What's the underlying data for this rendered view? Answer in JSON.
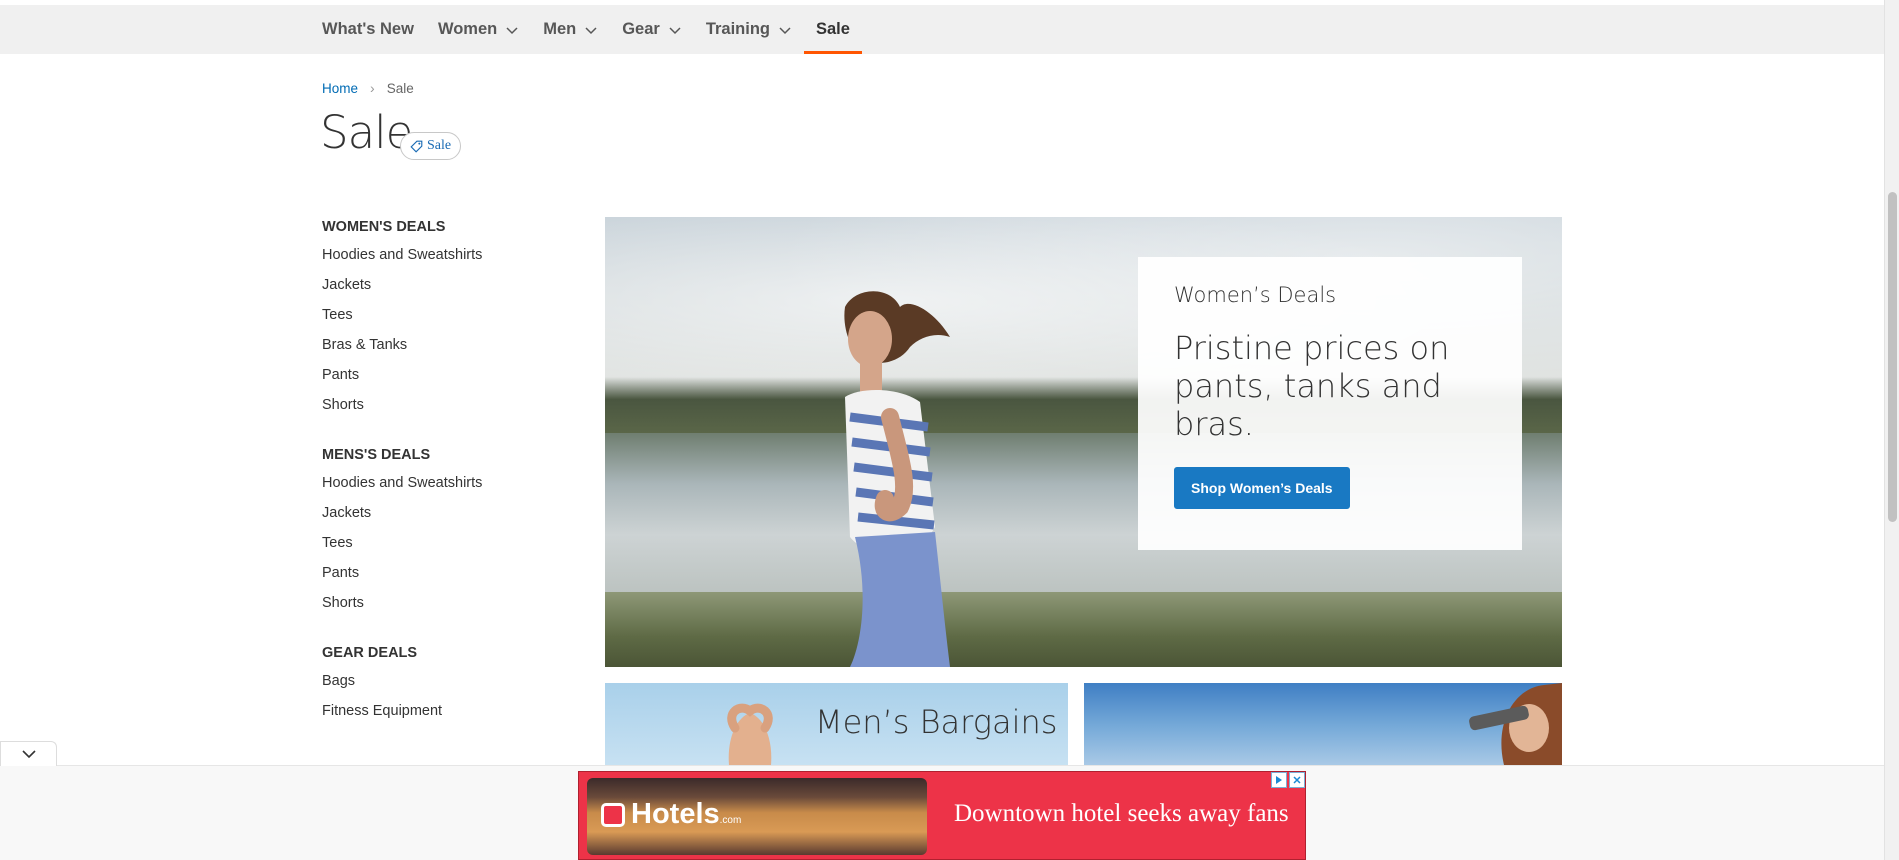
{
  "nav": {
    "items": [
      {
        "label": "What's New",
        "has_dropdown": false
      },
      {
        "label": "Women",
        "has_dropdown": true
      },
      {
        "label": "Men",
        "has_dropdown": true
      },
      {
        "label": "Gear",
        "has_dropdown": true
      },
      {
        "label": "Training",
        "has_dropdown": true
      },
      {
        "label": "Sale",
        "has_dropdown": false,
        "active": true
      }
    ]
  },
  "breadcrumb": {
    "home": "Home",
    "current": "Sale"
  },
  "page": {
    "title": "Sale",
    "tag_label": "Sale"
  },
  "sidebar": {
    "groups": [
      {
        "heading": "WOMEN'S DEALS",
        "links": [
          "Hoodies and Sweatshirts",
          "Jackets",
          "Tees",
          "Bras & Tanks",
          "Pants",
          "Shorts"
        ]
      },
      {
        "heading": "MENS'S DEALS",
        "links": [
          "Hoodies and Sweatshirts",
          "Jackets",
          "Tees",
          "Pants",
          "Shorts"
        ]
      },
      {
        "heading": "GEAR DEALS",
        "links": [
          "Bags",
          "Fitness Equipment"
        ]
      }
    ]
  },
  "hero": {
    "subtitle": "Women’s Deals",
    "headline": "Pristine prices on pants, tanks and bras.",
    "button_label": "Shop Women’s Deals"
  },
  "tiles": {
    "men_title": "Men’s Bargains"
  },
  "ad": {
    "brand": "Hotels",
    "brand_suffix": ".com",
    "text": "Downtown hotel seeks away fans"
  },
  "colors": {
    "accent": "#ff5501",
    "primary_button": "#1979c3",
    "link": "#006bb4",
    "ad_bg": "#ed3348"
  }
}
